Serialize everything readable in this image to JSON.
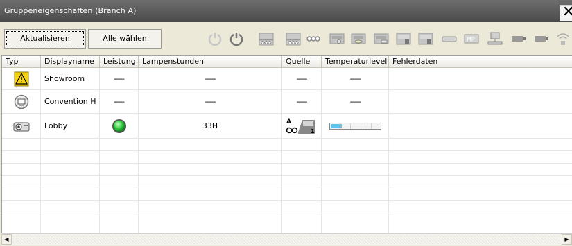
{
  "window": {
    "title": "Gruppeneigenschaften (Branch A)",
    "close_glyph": "✕"
  },
  "toolbar": {
    "refresh_label": "Aktualisieren",
    "select_all_label": "Alle wählen",
    "icons": [
      "power-off-icon",
      "power-on-icon",
      "input-comp-1-icon",
      "input-comp-2-icon",
      "input-extra-icon",
      "input-video-icon",
      "input-svideo-icon",
      "input-hdmi-icon",
      "input-rgb-1-icon",
      "input-rgb-2-icon",
      "input-bnc-icon",
      "input-mp-icon",
      "network-icon",
      "input-dvi-1-icon",
      "input-dvi-2-icon",
      "wireless-icon"
    ]
  },
  "table": {
    "columns": [
      "Typ",
      "Displayname",
      "Leistung",
      "Lampenstunden",
      "Quelle",
      "Temperaturlevel",
      "Fehlerdaten"
    ],
    "rows": [
      {
        "type_icon": "warning-projector-icon",
        "name": "Showroom",
        "power": "-----",
        "lamp_hours": "-----",
        "source": "-----",
        "temp": "-----",
        "errors": ""
      },
      {
        "type_icon": "offline-projector-icon",
        "name": "Convention H",
        "power": "-----",
        "lamp_hours": "-----",
        "source": "-----",
        "temp": "-----",
        "errors": ""
      },
      {
        "type_icon": "projector-icon",
        "name": "Lobby",
        "power": "power-on-led-icon",
        "lamp_hours": "33H",
        "source": "input-a-rgb1-icon",
        "temp_level": 0.22,
        "errors": ""
      }
    ]
  },
  "colors": {
    "titlebar": "#5a5a5a",
    "led": "#2ecc40",
    "temp_fill": "#5fc3f0",
    "warning": "#f5d10f"
  }
}
